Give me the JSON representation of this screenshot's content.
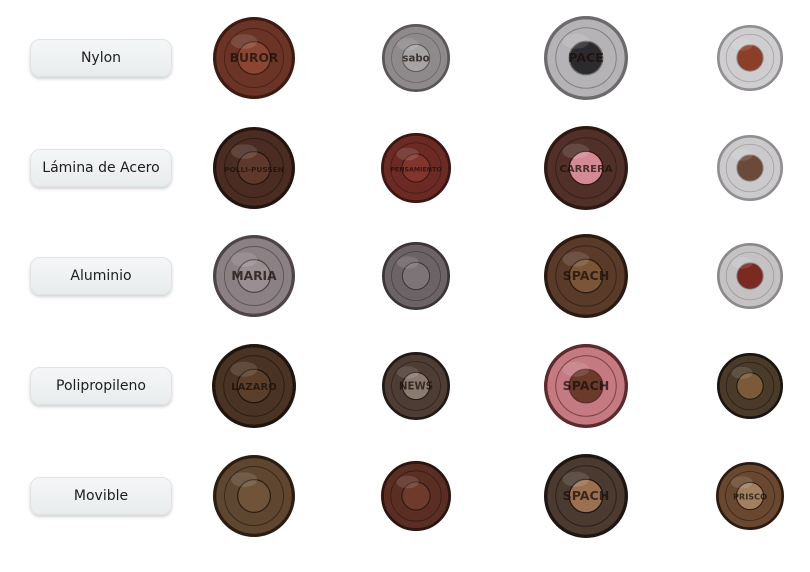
{
  "categories": [
    {
      "label": "Nylon",
      "buttons": [
        {
          "icon": "buttons-brand-buton",
          "text": "BUROR",
          "rim": "#3d1b12",
          "face": "#6b3426",
          "inner": "#8a4632"
        },
        {
          "icon": "button-sabo",
          "text": "sabo",
          "rim": "#5a5658",
          "face": "#8e8a8c",
          "inner": "#a7a2a3"
        },
        {
          "icon": "button-pace",
          "text": "PACE",
          "rim": "#6c6a6d",
          "face": "#b5b3b5",
          "inner": "#2b2a2c"
        },
        {
          "icon": "button-ring-copper",
          "text": "",
          "rim": "#8f8e90",
          "face": "#cfcdcf",
          "inner": "#8b3e28"
        }
      ]
    },
    {
      "label": "Lámina de Acero",
      "buttons": [
        {
          "icon": "button-polli-pussen",
          "text": "POLLI-PUSSEN",
          "rim": "#241410",
          "face": "#4a2c22",
          "inner": "#5e382b"
        },
        {
          "icon": "button-pensamiento",
          "text": "PENSAMIENTO",
          "rim": "#3a1513",
          "face": "#6c2a24",
          "inner": "#82352d"
        },
        {
          "icon": "button-carrera",
          "text": "CARRERA",
          "rim": "#2d1813",
          "face": "#52302a",
          "inner": "#d38a95"
        },
        {
          "icon": "button-ring-silver",
          "text": "",
          "rim": "#8f8e90",
          "face": "#cbc9cb",
          "inner": "#6b4a3a"
        }
      ]
    },
    {
      "label": "Aluminio",
      "buttons": [
        {
          "icon": "button-maria",
          "text": "MARIA",
          "rim": "#4d4446",
          "face": "#8b8083",
          "inner": "#9a8e91"
        },
        {
          "icon": "button-polli-pussen-grey",
          "text": "",
          "rim": "#3b3537",
          "face": "#6b6366",
          "inner": "#7c7477"
        },
        {
          "icon": "button-spach-originals",
          "text": "SPACH",
          "rim": "#2a1a12",
          "face": "#5a3b2a",
          "inner": "#7a5538"
        },
        {
          "icon": "button-ring-red",
          "text": "",
          "rim": "#8a8889",
          "face": "#c4c2c3",
          "inner": "#7a2a20"
        }
      ]
    },
    {
      "label": "Polipropileno",
      "buttons": [
        {
          "icon": "button-lazaro",
          "text": "LAZARO",
          "rim": "#1f150e",
          "face": "#4a3322",
          "inner": "#5c3f2a"
        },
        {
          "icon": "button-original-news",
          "text": "NEWS",
          "rim": "#221a16",
          "face": "#4d3d34",
          "inner": "#8a7a70"
        },
        {
          "icon": "button-spach-pink",
          "text": "SPACH",
          "rim": "#5a2a2c",
          "face": "#c47a80",
          "inner": "#6a3a2a"
        },
        {
          "icon": "button-star",
          "text": "",
          "rim": "#1a1410",
          "face": "#4a3a2a",
          "inner": "#7a5a38"
        }
      ]
    },
    {
      "label": "Movible",
      "buttons": [
        {
          "icon": "button-jeans-figure",
          "text": "",
          "rim": "#2b1d12",
          "face": "#5e4630",
          "inner": "#6f5439"
        },
        {
          "icon": "button-stars",
          "text": "",
          "rim": "#2a1510",
          "face": "#5a2e22",
          "inner": "#6e3a2c"
        },
        {
          "icon": "button-spach-dark",
          "text": "SPACH",
          "rim": "#1e1612",
          "face": "#4a3a30",
          "inner": "#9a7050"
        },
        {
          "icon": "button-prisco",
          "text": "PRISCO",
          "rim": "#2a1a12",
          "face": "#6a4830",
          "inner": "#a08060"
        }
      ]
    }
  ]
}
